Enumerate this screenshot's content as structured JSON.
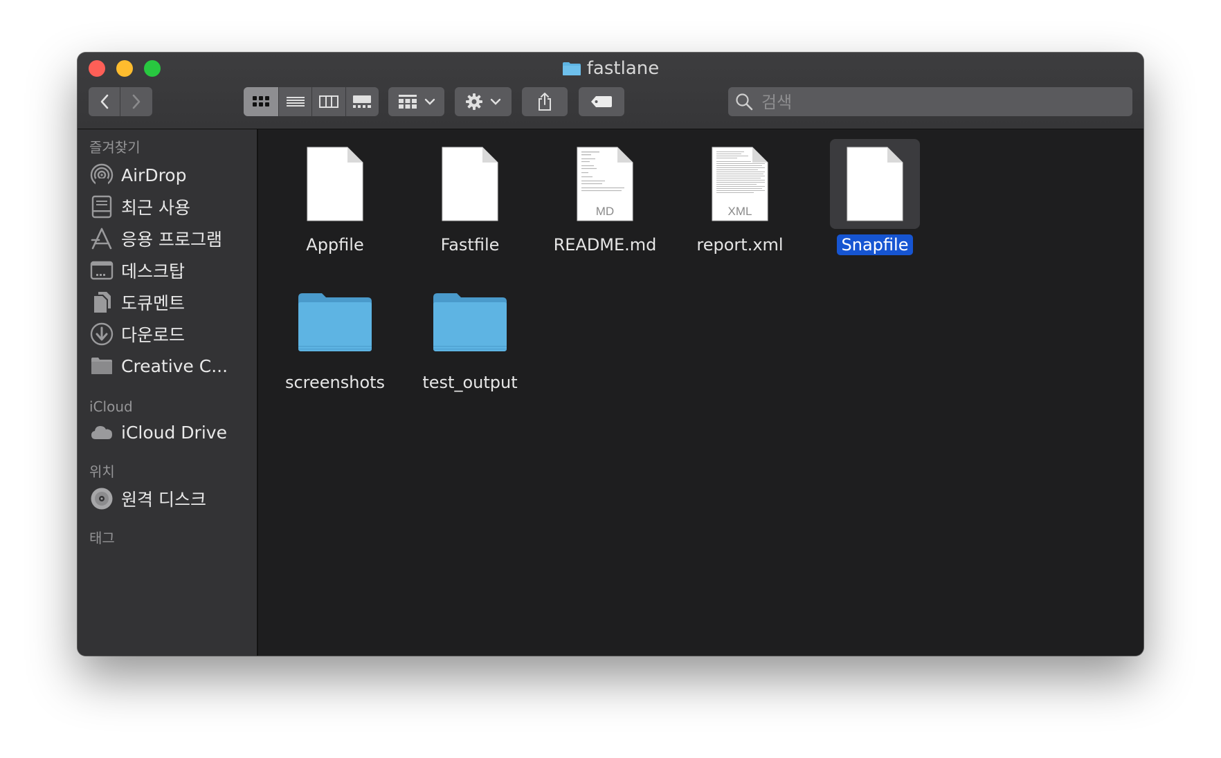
{
  "window": {
    "title": "fastlane"
  },
  "toolbar": {
    "back": "back",
    "forward": "forward",
    "view_modes": [
      "icon-view",
      "list-view",
      "column-view",
      "gallery-view"
    ],
    "group_by": "group",
    "action": "action",
    "share": "share",
    "tag": "tag"
  },
  "search": {
    "placeholder": "검색",
    "value": ""
  },
  "sidebar": {
    "favorites_header": "즐겨찾기",
    "favorites": [
      {
        "label": "AirDrop",
        "icon": "airdrop-icon"
      },
      {
        "label": "최근 사용",
        "icon": "recents-icon"
      },
      {
        "label": "응용 프로그램",
        "icon": "applications-icon"
      },
      {
        "label": "데스크탑",
        "icon": "desktop-icon"
      },
      {
        "label": "도큐멘트",
        "icon": "documents-icon"
      },
      {
        "label": "다운로드",
        "icon": "downloads-icon"
      },
      {
        "label": "Creative C...",
        "icon": "folder-icon"
      }
    ],
    "icloud_header": "iCloud",
    "icloud": [
      {
        "label": "iCloud Drive",
        "icon": "cloud-icon"
      }
    ],
    "locations_header": "위치",
    "locations": [
      {
        "label": "원격 디스크",
        "icon": "disc-icon"
      }
    ],
    "tags_header": "태그"
  },
  "files": [
    {
      "name": "Appfile",
      "kind": "document",
      "badge": ""
    },
    {
      "name": "Fastfile",
      "kind": "document",
      "badge": ""
    },
    {
      "name": "README.md",
      "kind": "text-document",
      "badge": "MD"
    },
    {
      "name": "report.xml",
      "kind": "text-document",
      "badge": "XML"
    },
    {
      "name": "Snapfile",
      "kind": "document",
      "badge": "",
      "selected": true
    },
    {
      "name": "screenshots",
      "kind": "folder",
      "badge": ""
    },
    {
      "name": "test_output",
      "kind": "folder",
      "badge": ""
    }
  ],
  "colors": {
    "selection": "#1655d2",
    "folder": "#5eb4e3",
    "window_bg": "#1e1e1f",
    "sidebar_bg": "#333335"
  }
}
